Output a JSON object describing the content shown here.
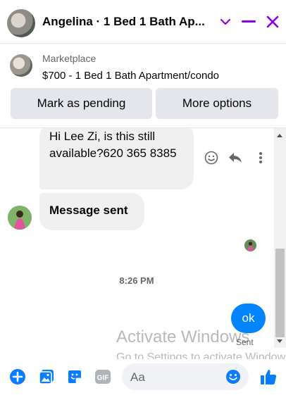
{
  "header": {
    "title": "Angelina · 1 Bed 1 Bath Ap...",
    "icons": [
      "chevron-down-icon",
      "minimize-icon",
      "close-icon"
    ],
    "accent_color": "#8a00e6"
  },
  "marketplace": {
    "label": "Marketplace",
    "listing_title": "$700 - 1 Bed 1 Bath Apartment/condo",
    "buttons": {
      "pending": "Mark as pending",
      "options": "More options"
    }
  },
  "messages": {
    "incoming": [
      {
        "text": "Hi Lee Zi, is this still available?620 365 8385"
      },
      {
        "text": "Message sent"
      }
    ],
    "timestamp": "8:26 PM",
    "outgoing": {
      "text": "ok",
      "status": "Sent"
    }
  },
  "composer": {
    "placeholder": "Aa",
    "icons": [
      "plus-circle-icon",
      "image-icon",
      "sticker-icon",
      "gif-icon",
      "emoji-icon",
      "like-icon"
    ]
  },
  "watermark": {
    "line1": "Activate Windows",
    "line2": "Go to Settings to activate Windows."
  },
  "colors": {
    "brand_blue": "#0084ff",
    "bubble_gray": "#f0f0f0",
    "button_gray": "#e4e6eb"
  }
}
